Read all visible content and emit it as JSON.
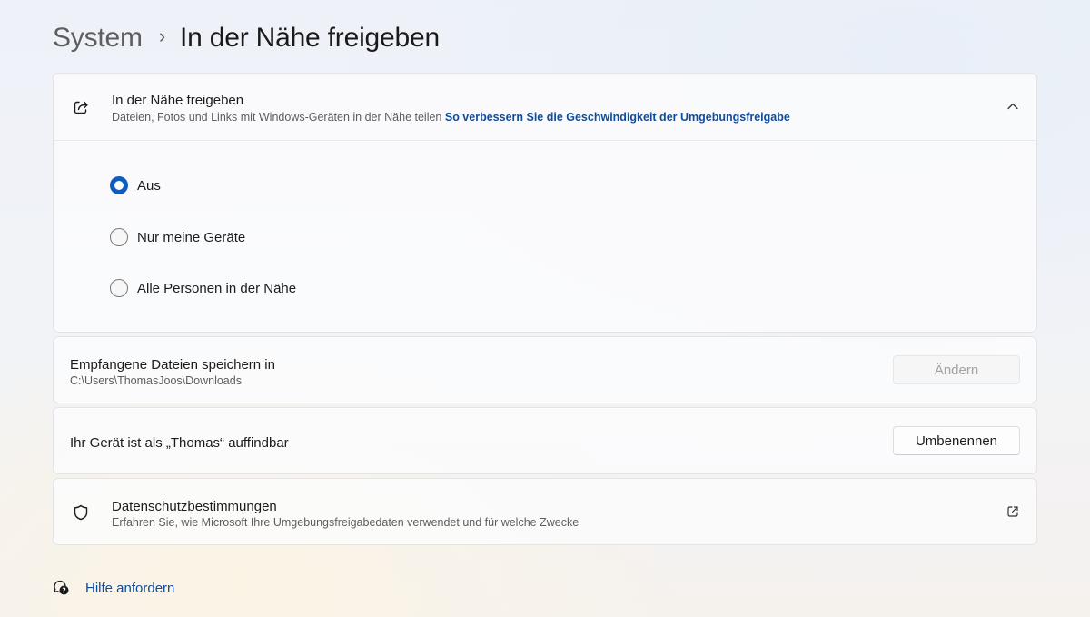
{
  "breadcrumb": {
    "parent": "System",
    "separator": "›",
    "current": "In der Nähe freigeben"
  },
  "nearby_sharing": {
    "icon": "share-icon",
    "title": "In der Nähe freigeben",
    "subtitle": "Dateien, Fotos und Links mit Windows-Geräten in der Nähe teilen",
    "link": "So verbessern Sie die Geschwindigkeit der Umgebungsfreigabe",
    "expanded": true,
    "options": [
      {
        "label": "Aus",
        "selected": true
      },
      {
        "label": "Nur meine Geräte",
        "selected": false
      },
      {
        "label": "Alle Personen in der Nähe",
        "selected": false
      }
    ]
  },
  "save_location": {
    "title": "Empfangene Dateien speichern in",
    "path": "C:\\Users\\ThomasJoos\\Downloads",
    "button_label": "Ändern",
    "button_enabled": false
  },
  "device_name": {
    "title": "Ihr Gerät ist als „Thomas“ auffindbar",
    "button_label": "Umbenennen"
  },
  "privacy": {
    "icon": "shield-icon",
    "title": "Datenschutzbestimmungen",
    "subtitle": "Erfahren Sie, wie Microsoft Ihre Umgebungsfreigabedaten verwendet und für welche Zwecke",
    "action_icon": "external-link-icon"
  },
  "help": {
    "icon": "help-chat-icon",
    "label": "Hilfe anfordern"
  },
  "colors": {
    "accent": "#0f5cc0",
    "link": "#0f4c9a"
  }
}
